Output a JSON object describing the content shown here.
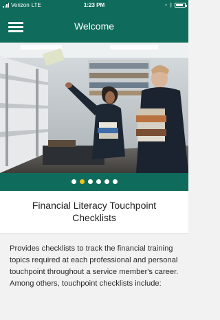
{
  "status_bar": {
    "carrier": "Verizon",
    "network": "LTE",
    "time": "1:23 PM"
  },
  "header": {
    "title": "Welcome",
    "menu_icon": "hamburger-menu-icon"
  },
  "carousel": {
    "dot_count": 6,
    "active_index": 1
  },
  "content": {
    "title": "Financial Literacy Touchpoint Checklists",
    "description": "Provides checklists to track the financial training topics required at each professional and personal touchpoint throughout a service member's career. Among others, touchpoint checklists include:"
  },
  "colors": {
    "primary": "#0f6b5b",
    "active_dot": "#f2c21a"
  }
}
